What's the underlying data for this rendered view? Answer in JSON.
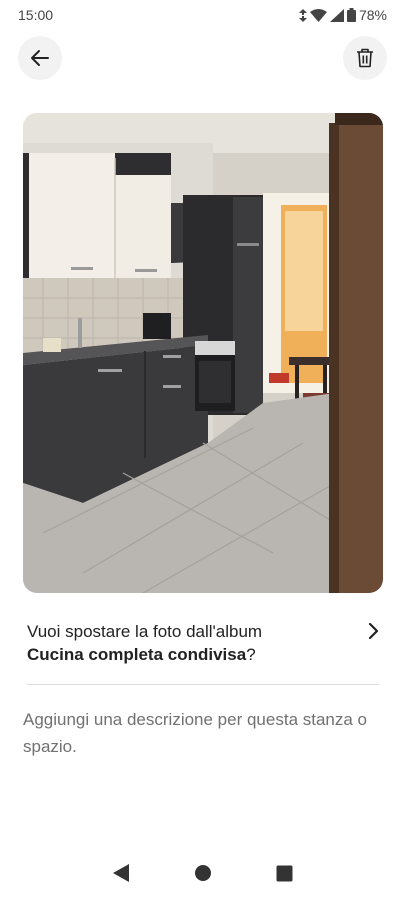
{
  "status_bar": {
    "time": "15:00",
    "battery": "78%"
  },
  "toolbar": {
    "back_icon": "arrow-left-icon",
    "delete_icon": "trash-icon"
  },
  "photo": {
    "subject": "kitchen"
  },
  "album_prompt": {
    "line1": "Vuoi spostare la foto dall'album",
    "album_name": "Cucina completa condivisa",
    "suffix": "?"
  },
  "description": {
    "placeholder": "Aggiungi una descrizione per questa stanza o spazio."
  },
  "nav": {
    "back": "nav-back-icon",
    "home": "nav-home-icon",
    "recents": "nav-recents-icon"
  }
}
